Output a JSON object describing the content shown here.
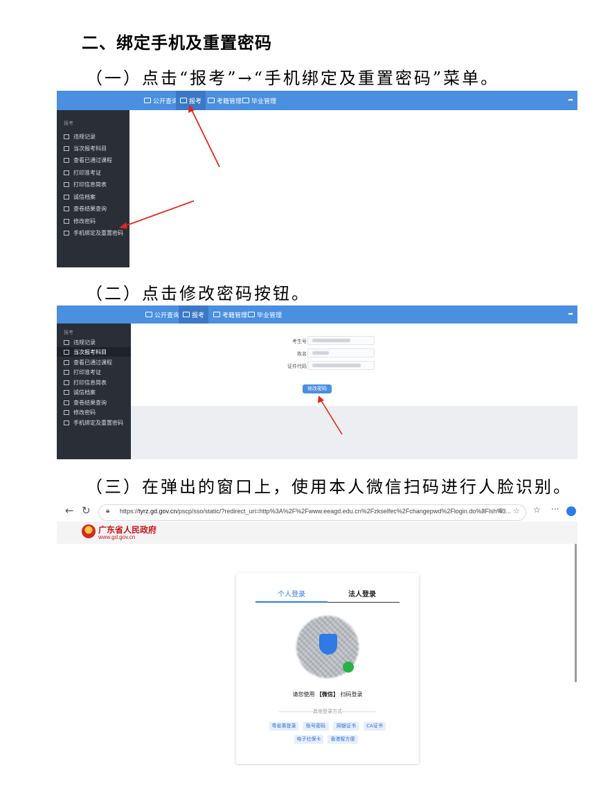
{
  "heading": "二、绑定手机及重置密码",
  "steps": {
    "s1": "（一）点击“报考”→“手机绑定及重置密码”菜单。",
    "s2": "（二）点击修改密码按钮。",
    "s3": "（三）在弹出的窗口上，使用本人微信扫码进行人脸识别。"
  },
  "nav": {
    "items": [
      "公开查询",
      "报考",
      "考籍管理",
      "毕业管理"
    ],
    "active": "报考",
    "exit_icon": "logout-icon"
  },
  "sidebar": {
    "header": "报考",
    "items": [
      "违规记录",
      "当次报考科目",
      "查看已通过课程",
      "打印准考证",
      "打印信息简表",
      "诚信档案",
      "查卷结果查询",
      "修改密码",
      "手机绑定及重置密码"
    ]
  },
  "form": {
    "fields": [
      {
        "label": "考生号"
      },
      {
        "label": "姓名"
      },
      {
        "label": "证件代码"
      }
    ],
    "submit_label": "修改密码"
  },
  "browser": {
    "url_prefix": "https://",
    "url_host": "tyrz.gd.gov.cn",
    "url_rest": "/pscp/sso/static/?redirect_uri=http%3A%2F%2Fwww.eeagd.edu.cn%2Fzkselfec%2Fchangepwd%2Flogin.do%3Flsh%3...",
    "gov_name": "广东省人民政府",
    "gov_url": "www.gd.gov.cn"
  },
  "login": {
    "tab_personal": "个人登录",
    "tab_legal": "法人登录",
    "scan_hint_pre": "请您使用",
    "scan_hint_app": "【微信】",
    "scan_hint_post": "扫码登录",
    "other_methods": "其他登录方式",
    "methods_row1": [
      "粤省事登录",
      "账号密码",
      "网银证书",
      "CA证书"
    ],
    "methods_row2": [
      "电子社保卡",
      "香港智方便"
    ]
  },
  "colors": {
    "nav_blue": "#4a8fe0",
    "sidebar_dark": "#2a2f37",
    "arrow_red": "#e0261a",
    "gov_red": "#c8161d"
  }
}
